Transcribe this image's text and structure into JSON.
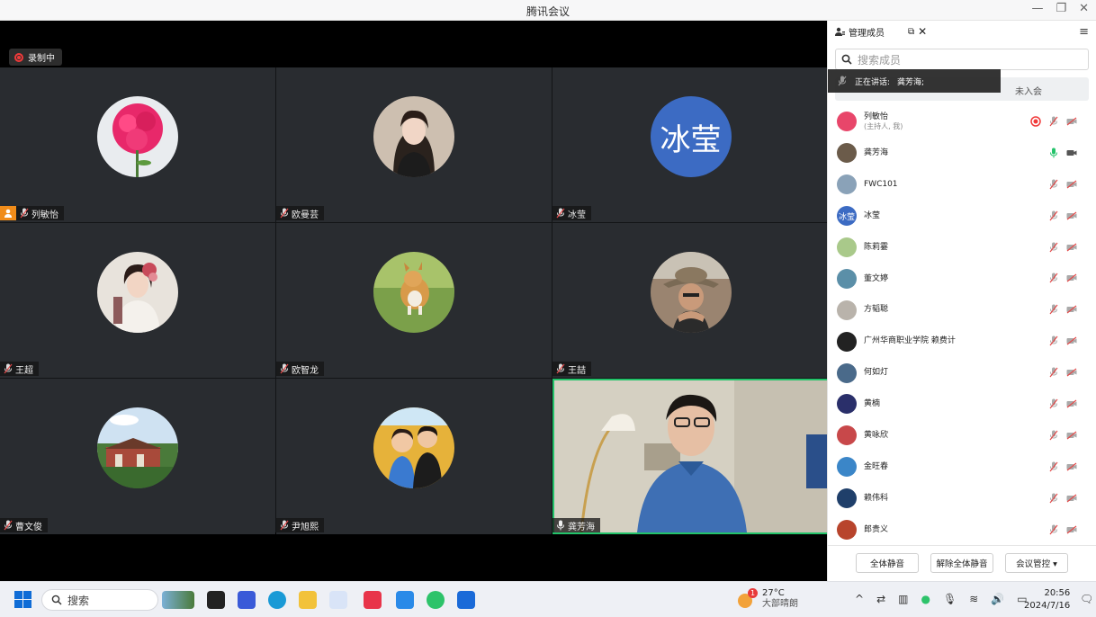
{
  "window": {
    "title": "腾讯会议",
    "min_icon": "minimize-icon",
    "max_icon": "restore-icon",
    "close_icon": "close-icon"
  },
  "recording": {
    "label": "录制中"
  },
  "tiles": [
    {
      "name": "列敏怡",
      "avatar": "flower",
      "host": true
    },
    {
      "name": "欧曼芸",
      "avatar": "photo-woman"
    },
    {
      "name": "冰莹",
      "avatar_text": "冰莹"
    },
    {
      "name": "王超",
      "avatar": "photo-costume"
    },
    {
      "name": "欧智龙",
      "avatar": "photo-corgi"
    },
    {
      "name": "王喆",
      "avatar": "photo-man-hat"
    },
    {
      "name": "曹文俊",
      "avatar": "photo-building"
    },
    {
      "name": "尹旭熙",
      "avatar": "photo-kids"
    },
    {
      "name": "龚芳海",
      "video": true,
      "active": true
    }
  ],
  "panel": {
    "title": "管理成员",
    "search_placeholder": "搜索成员",
    "tab_not_joined": "未入会",
    "speaking_label": "正在讲话:",
    "speaking_name": "龚芳海;",
    "members": [
      {
        "name": "列敏怡",
        "sub": "(主持人, 我)",
        "color": "#e8466a",
        "rec": true
      },
      {
        "name": "龚芳海",
        "sub": "",
        "color": "#6b5b4a",
        "mic_on": true
      },
      {
        "name": "FWC101",
        "sub": "",
        "color": "#8aa2b8"
      },
      {
        "name": "冰莹",
        "sub": "",
        "color": "#3c6bc3",
        "text": "冰莹"
      },
      {
        "name": "陈莉霎",
        "sub": "",
        "color": "#a9c98a"
      },
      {
        "name": "董文婷",
        "sub": "",
        "color": "#5b8fa8"
      },
      {
        "name": "方韬聪",
        "sub": "",
        "color": "#b9b3ab"
      },
      {
        "name": "广州华商职业学院 赖费计",
        "sub": "",
        "color": "#222222"
      },
      {
        "name": "何如灯",
        "sub": "",
        "color": "#4a6a8a"
      },
      {
        "name": "黄楠",
        "sub": "",
        "color": "#2a2f6a"
      },
      {
        "name": "黄咏欣",
        "sub": "",
        "color": "#c8484a"
      },
      {
        "name": "金旺春",
        "sub": "",
        "color": "#3b86c8"
      },
      {
        "name": "赖伟科",
        "sub": "",
        "color": "#1f3f6a"
      },
      {
        "name": "郎贵义",
        "sub": "",
        "color": "#b8442c"
      }
    ],
    "btn_mute_all": "全体静音",
    "btn_unmute_all": "解除全体静音",
    "btn_control": "会议管控 ▾"
  },
  "taskbar": {
    "search_label": "搜索",
    "weather_temp": "27°C",
    "weather_desc": "大部晴朗",
    "weather_badge": "1",
    "time": "20:56",
    "date": "2024/7/16"
  }
}
